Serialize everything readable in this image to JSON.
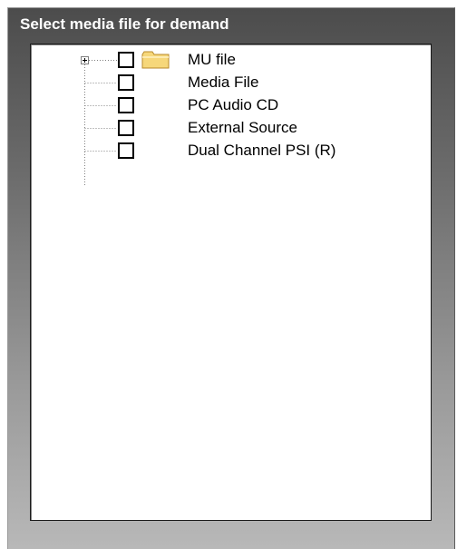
{
  "panel": {
    "title": "Select media file for demand"
  },
  "tree": {
    "items": [
      {
        "label": "MU file",
        "checked": false,
        "expandable": true,
        "icon": "folder-icon"
      },
      {
        "label": "Media File",
        "checked": false,
        "expandable": false
      },
      {
        "label": "PC Audio CD",
        "checked": false,
        "expandable": false
      },
      {
        "label": "External Source",
        "checked": false,
        "expandable": false
      },
      {
        "label": "Dual Channel PSI (R)",
        "checked": false,
        "expandable": false
      }
    ]
  },
  "colors": {
    "panel_top": "#4c4c4c",
    "panel_bottom": "#b8b8b8",
    "title_text": "#ffffff",
    "folder_fill": "#f6d77a",
    "folder_stroke": "#b88a2a"
  }
}
